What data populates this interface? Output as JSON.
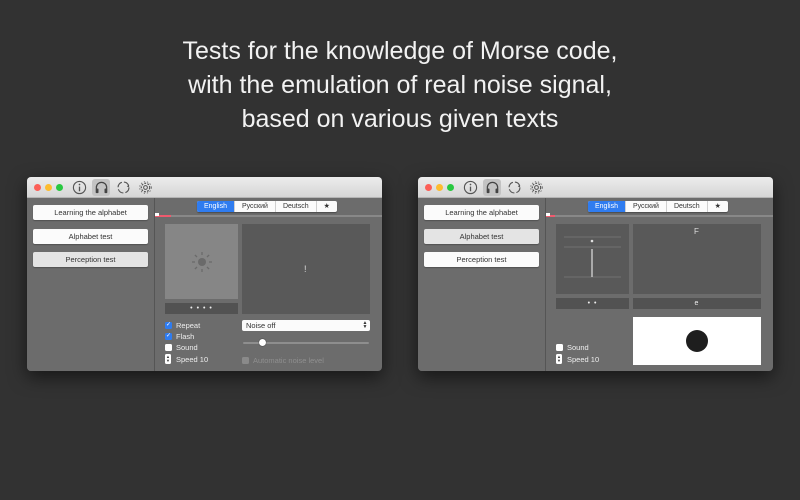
{
  "headline": {
    "line1": "Tests for the knowledge of Morse code,",
    "line2": "with the emulation of real noise signal,",
    "line3": "based on various given texts"
  },
  "toolbar_icons": [
    "info-icon",
    "headphones-icon",
    "sync-icon",
    "gear-icon"
  ],
  "menu": {
    "learning": "Learning the alphabet",
    "alphabet_test": "Alphabet test",
    "perception_test": "Perception test"
  },
  "languages": {
    "english": "English",
    "russian": "Русский",
    "deutsch": "Deutsch",
    "favorite": "★"
  },
  "left_window": {
    "selected_menu": "Perception test",
    "selected_language": "English",
    "dots": "• • • •",
    "glyph_symbol": "!",
    "repeat_label": "Repeat",
    "repeat_checked": true,
    "flash_label": "Flash",
    "flash_checked": true,
    "sound_label": "Sound",
    "sound_checked": false,
    "speed_label": "Speed 10",
    "noise_select": "Noise off",
    "noise_level": 0.15,
    "auto_noise_label": "Automatic noise level",
    "progress": 0.07
  },
  "right_window": {
    "selected_menu": "Alphabet test",
    "selected_language": "English",
    "letter": "F",
    "dots": "• •",
    "answer": "e",
    "sound_label": "Sound",
    "sound_checked": false,
    "speed_label": "Speed 10",
    "progress": 0.04
  },
  "colors": {
    "background": "#323232",
    "accent_blue": "#2f7cf0",
    "progress_red": "#ef5a6e"
  }
}
